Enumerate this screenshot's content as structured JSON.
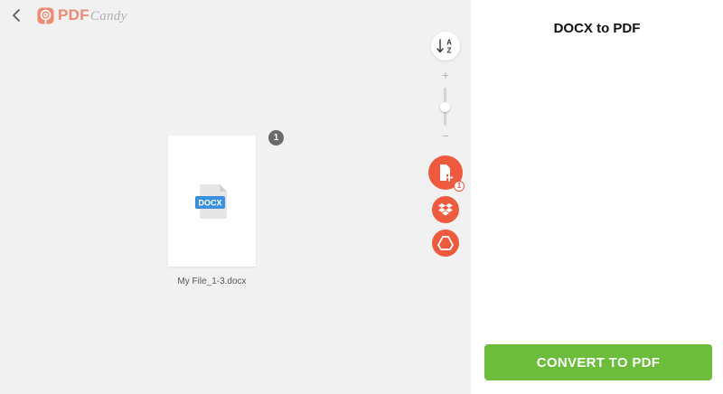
{
  "header": {
    "back_icon": "chevron-left-icon",
    "logo_pdf": "PDF",
    "logo_candy": "Candy",
    "brand_color": "#f18a74"
  },
  "toolbar": {
    "sort_icon": "sort-az-icon",
    "sort_letter_top": "A",
    "sort_letter_bottom": "Z",
    "zoom_plus": "+",
    "zoom_minus": "−",
    "zoom_level": 0.5,
    "add_file_badge": "1",
    "accent_color": "#ee5a3d"
  },
  "file": {
    "name": "My File_1-3.docx",
    "type_label": "DOCX",
    "count": "1"
  },
  "panel": {
    "title": "DOCX to PDF",
    "convert_label": "CONVERT TO PDF",
    "convert_color": "#6dbd3d"
  }
}
